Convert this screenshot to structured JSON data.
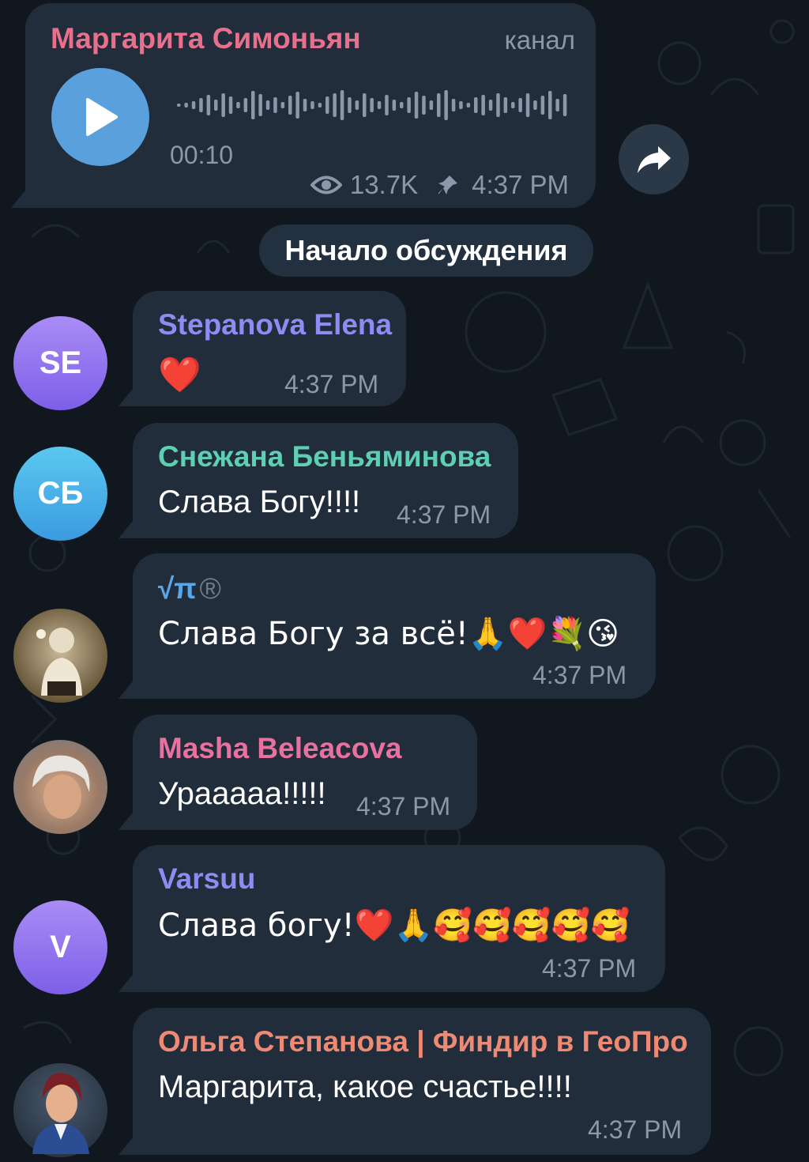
{
  "post": {
    "channel_name": "Маргарита Симоньян",
    "channel_label": "канал",
    "duration": "00:10",
    "views": "13.7K",
    "time": "4:37 PM",
    "play_icon": "play-icon",
    "views_icon": "eye-icon",
    "pin_icon": "pin-icon"
  },
  "share_icon": "share-icon",
  "service_message": "Начало обсуждения",
  "messages": [
    {
      "sender": "Stepanova Elena",
      "sender_color": "#8f8bf2",
      "avatar_initials": "SE",
      "text": "❤️",
      "time": "4:37 PM"
    },
    {
      "sender": "Снежана Беньяминова",
      "sender_color": "#5fcfb4",
      "avatar_initials": "СБ",
      "text": "Слава Богу!!!!",
      "time": "4:37 PM"
    },
    {
      "sender": "√π",
      "sender_badge": "®",
      "sender_color": "#5aa7e8",
      "text": "Слава Богу за всё!🙏❤️💐😘",
      "time": "4:37 PM"
    },
    {
      "sender": "Masha Beleacova",
      "sender_color": "#e871a0",
      "text": "Урааааа!!!!!",
      "time": "4:37 PM"
    },
    {
      "sender": "Varsuu",
      "sender_color": "#8f8bf2",
      "avatar_initials": "V",
      "text": "Слава богу!❤️🙏🥰🥰🥰🥰🥰",
      "time": "4:37 PM"
    },
    {
      "sender": "Ольга Степанова | Финдир в ГеоПро",
      "sender_color": "#ee8a73",
      "text": "Маргарита, какое счастье!!!!",
      "time": "4:37 PM"
    }
  ],
  "colors": {
    "background": "#10171f",
    "bubble": "#212d3b",
    "accent": "#5aa0dc",
    "meta": "#8a98a8"
  }
}
